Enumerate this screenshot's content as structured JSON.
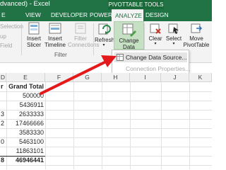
{
  "titlebar": {
    "title": "dvanced) - Excel",
    "context_group": "PIVOTTABLE TOOLS"
  },
  "tabs": [
    {
      "label": "E"
    },
    {
      "label": "VIEW"
    },
    {
      "label": "DEVELOPER"
    },
    {
      "label": "POWERPIVOT"
    },
    {
      "label": "ANALYZE"
    },
    {
      "label": "DESIGN"
    }
  ],
  "ribbon": {
    "left_partial": [
      "Selection",
      "up",
      "Field"
    ],
    "insert_slicer": "Insert\nSlicer",
    "insert_timeline": "Insert\nTimeline",
    "filter_connections": "Filter\nConnections",
    "filter_group": "Filter",
    "refresh": "Refresh",
    "change_data_source": "Change Data\nSource",
    "clear": "Clear",
    "select": "Select",
    "move_pivottable": "Move\nPivotTable"
  },
  "dropdown": {
    "items": [
      {
        "label": "Change Data Source...",
        "icon": "change-data-source-icon",
        "enabled": true
      },
      {
        "label": "Connection Properties...",
        "enabled": false
      }
    ]
  },
  "grid": {
    "columns": [
      "D",
      "E",
      "F",
      "G",
      "H",
      "I",
      "J",
      "K"
    ],
    "rows": [
      {
        "d": "r",
        "e": "Grand Total",
        "bold": true
      },
      {
        "d": "",
        "e": "500000"
      },
      {
        "d": "",
        "e": "5436911"
      },
      {
        "d": "3",
        "e": "2633333"
      },
      {
        "d": "2",
        "e": "17466666"
      },
      {
        "d": "",
        "e": "3583330"
      },
      {
        "d": "0",
        "e": "5463100"
      },
      {
        "d": "",
        "e": "11863101"
      },
      {
        "d": "8",
        "e": "46946441",
        "bold": true
      }
    ]
  },
  "colors": {
    "excel_green": "#217346",
    "annotation_red": "#e3191c"
  }
}
